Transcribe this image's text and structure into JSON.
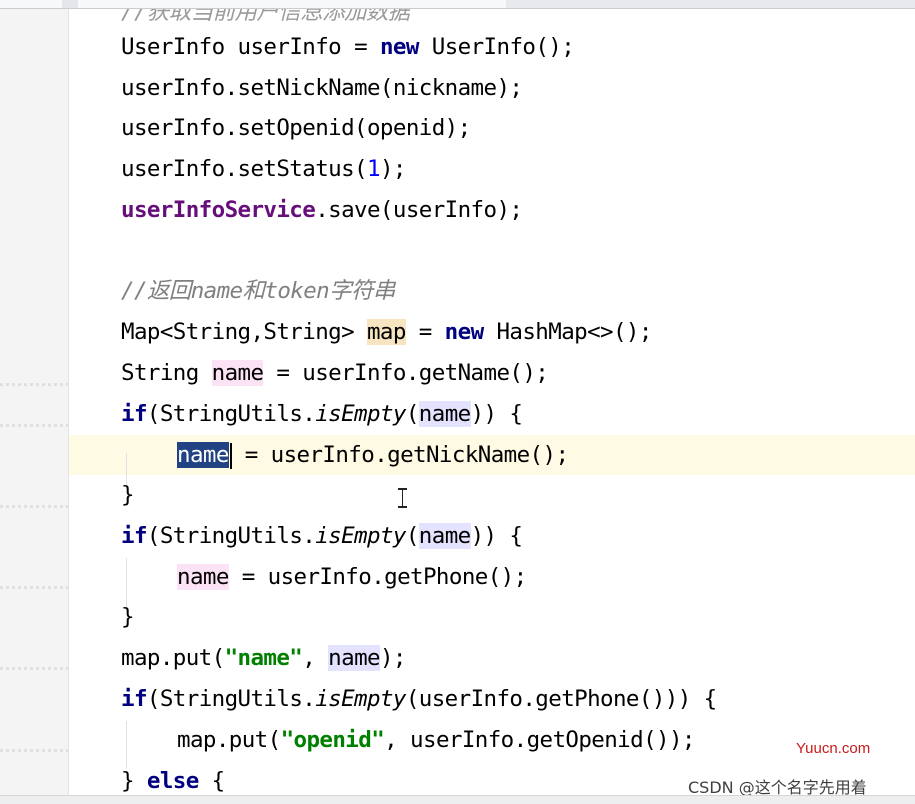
{
  "code": {
    "cut_comment": "//获取当前用户信息添加数据",
    "l1": {
      "type": "UserInfo",
      "var": "userInfo",
      "op": "=",
      "kw": "new",
      "ctor": "UserInfo",
      "end": "();"
    },
    "l2": {
      "text": "userInfo.setNickName(nickname);"
    },
    "l3": {
      "text": "userInfo.setOpenid(openid);"
    },
    "l4": {
      "pre": "userInfo.setStatus(",
      "num": "1",
      "post": ");"
    },
    "l5": {
      "field": "userInfoService",
      "post": ".save(userInfo);"
    },
    "l6": {
      "comment": "//返回name和token字符串"
    },
    "l7": {
      "pre": "Map<String,String> ",
      "var": "map",
      "mid": " = ",
      "kw": "new",
      "post": " HashMap<>();"
    },
    "l8": {
      "pre": "String ",
      "var": "name",
      "post": " = userInfo.getName();"
    },
    "l9": {
      "kw": "if",
      "pre": "(StringUtils.",
      "method": "isEmpty",
      "p1": "(",
      "var": "name",
      "post": ")) {"
    },
    "l10": {
      "var": "name",
      "post": " = userInfo.getNickName();"
    },
    "l11": {
      "text": "}"
    },
    "l12": {
      "kw": "if",
      "pre": "(StringUtils.",
      "method": "isEmpty",
      "p1": "(",
      "var": "name",
      "post": ")) {"
    },
    "l13": {
      "var": "name",
      "post": " = userInfo.getPhone();"
    },
    "l14": {
      "text": "}"
    },
    "l15": {
      "pre": "map.put(",
      "str": "\"name\"",
      "mid": ", ",
      "var": "name",
      "post": ");"
    },
    "l16": {
      "kw": "if",
      "pre": "(StringUtils.",
      "method": "isEmpty",
      "post": "(userInfo.getPhone())) {"
    },
    "l17": {
      "pre": "map.put(",
      "str": "\"openid\"",
      "post": ", userInfo.getOpenid());"
    },
    "l18": {
      "pre": "} ",
      "kw": "else",
      "post": " {"
    }
  },
  "watermark": {
    "site": "Yuucn.com",
    "csdn": "CSDN @这个名字先用着"
  }
}
